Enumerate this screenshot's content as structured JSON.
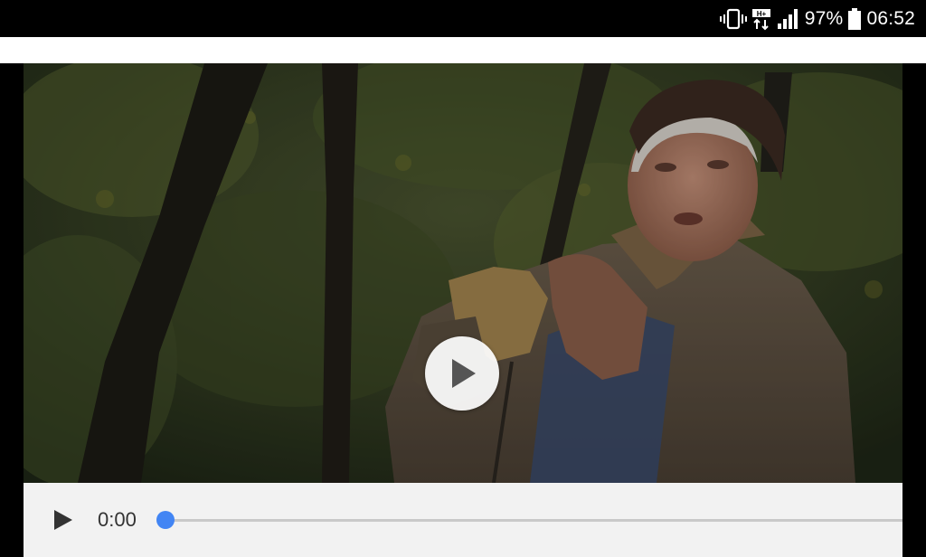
{
  "status_bar": {
    "battery_percent": "97%",
    "time": "06:52",
    "icons": [
      "vibrate-icon",
      "data-transfer-icon",
      "signal-icon",
      "battery-icon"
    ]
  },
  "video": {
    "description_icon": "play-icon",
    "overlay_button": "play-button"
  },
  "player_controls": {
    "current_time": "0:00",
    "progress_fraction": 0,
    "accent_color": "#4285f4"
  }
}
